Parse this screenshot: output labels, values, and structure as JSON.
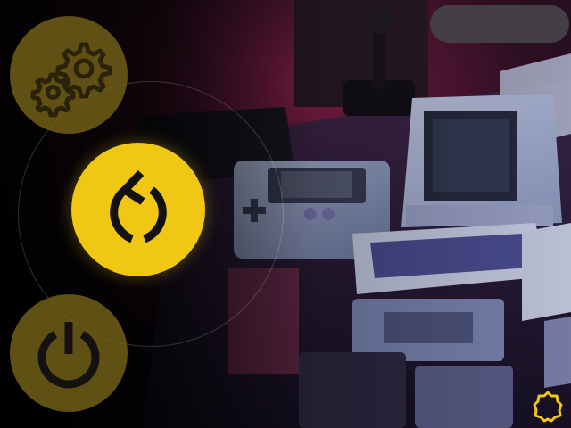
{
  "overlay": {
    "status_pill": "",
    "menu": {
      "items": [
        {
          "id": "settings",
          "icon": "gear-icon",
          "selected": false
        },
        {
          "id": "restart",
          "icon": "restart-icon",
          "selected": true
        },
        {
          "id": "power",
          "icon": "power-icon",
          "selected": false
        }
      ]
    },
    "logo_icon": "hexagon-logo-icon"
  },
  "colors": {
    "accent": "#f0c814",
    "accent_dim": "#7a6718",
    "icon_dark": "#141210",
    "icon_muted": "#2a230a",
    "pill": "#46464a",
    "background_glow": "#c8306a"
  }
}
